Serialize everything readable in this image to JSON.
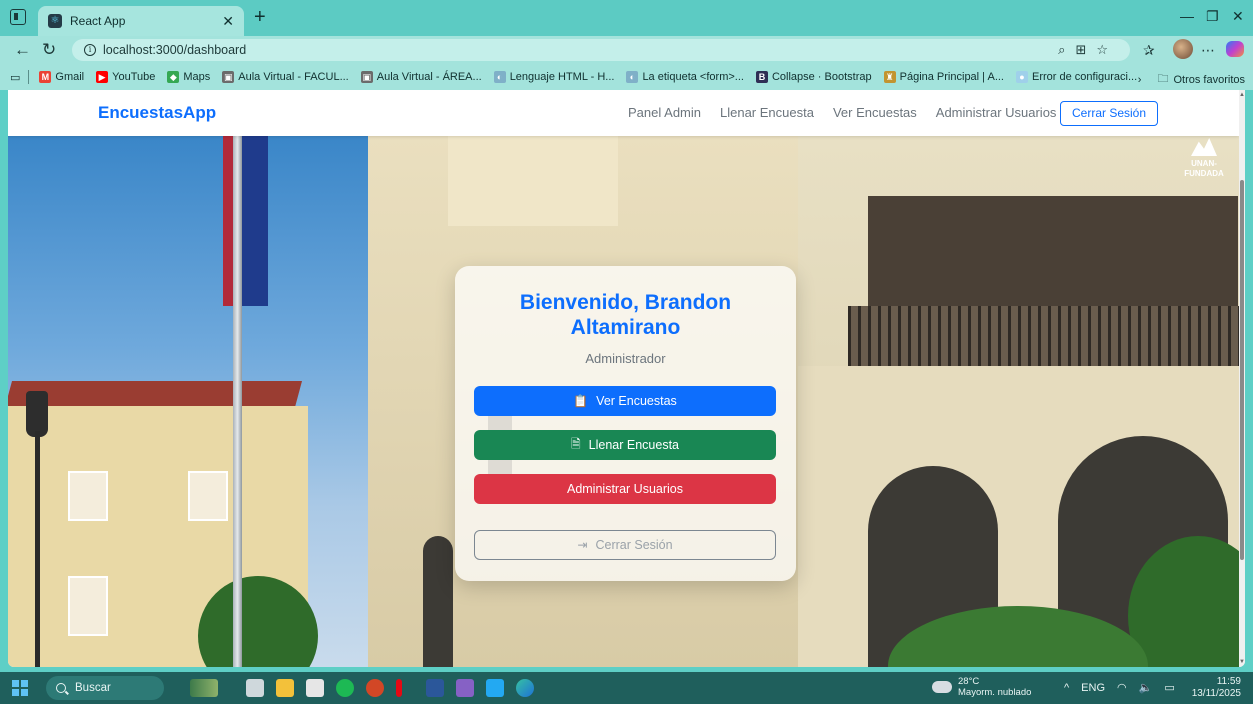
{
  "browser": {
    "tab_title": "React App",
    "url": "localhost:3000/dashboard",
    "bookmarks": [
      {
        "label": "Gmail",
        "color": "#ea4335",
        "glyph": "M"
      },
      {
        "label": "YouTube",
        "color": "#ff0000",
        "glyph": "▶"
      },
      {
        "label": "Maps",
        "color": "#34a853",
        "glyph": "◆"
      },
      {
        "label": "Aula Virtual - FACUL...",
        "color": "#6b6b6b",
        "glyph": "▣"
      },
      {
        "label": "Aula Virtual - ÁREA...",
        "color": "#6b6b6b",
        "glyph": "▣"
      },
      {
        "label": "Lenguaje HTML - H...",
        "color": "#7fb0c8",
        "glyph": "◐"
      },
      {
        "label": "La etiqueta <form>...",
        "color": "#7fb0c8",
        "glyph": "◐"
      },
      {
        "label": "Collapse · Bootstrap",
        "color": "#2f2f55",
        "glyph": "B"
      },
      {
        "label": "Página Principal | A...",
        "color": "#c29430",
        "glyph": "♜"
      },
      {
        "label": "Error de configuraci...",
        "color": "#9fd0ea",
        "glyph": "●"
      }
    ],
    "other_favorites": "Otros favoritos"
  },
  "navbar": {
    "brand": "EncuestasApp",
    "links": [
      "Panel Admin",
      "Llenar Encuesta",
      "Ver Encuestas",
      "Administrar Usuarios"
    ],
    "logout": "Cerrar Sesión"
  },
  "card": {
    "title": "Bienvenido, Brandon Altamirano",
    "role": "Administrador",
    "buttons": {
      "view_surveys": "Ver Encuestas",
      "fill_survey": "Llenar Encuesta",
      "manage_users": "Administrar Usuarios",
      "logout": "Cerrar Sesión"
    }
  },
  "hero": {
    "logo_text": "UNAN-FUNDADA"
  },
  "taskbar": {
    "search": "Buscar",
    "temperature": "28°C",
    "weather": "Mayorm. nublado",
    "language": "ENG",
    "time": "11:59",
    "date": "13/11/2025"
  },
  "colors": {
    "primary": "#0d6efd",
    "success": "#198754",
    "danger": "#dc3545",
    "secondary": "#6c757d"
  }
}
